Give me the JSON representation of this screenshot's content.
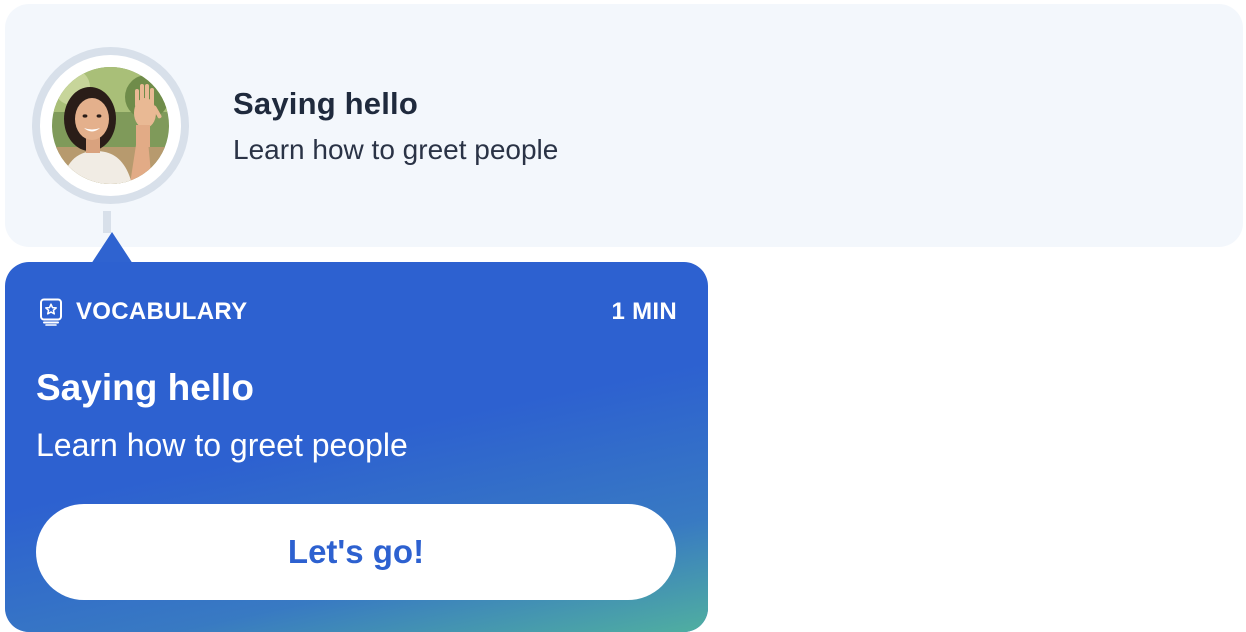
{
  "lesson": {
    "title": "Saying hello",
    "subtitle": "Learn how to greet people",
    "avatar": "person-waving-avatar"
  },
  "popover": {
    "category_icon": "vocabulary-card-star-icon",
    "category": "VOCABULARY",
    "duration": "1 MIN",
    "title": "Saying hello",
    "subtitle": "Learn how to greet people",
    "button_label": "Let's go!"
  },
  "colors": {
    "card_background": "#f3f7fc",
    "popover_blue": "#2d61d0",
    "popover_teal": "#50afa0",
    "title_text": "#1f2a3d",
    "button_text": "#2d61d0"
  }
}
